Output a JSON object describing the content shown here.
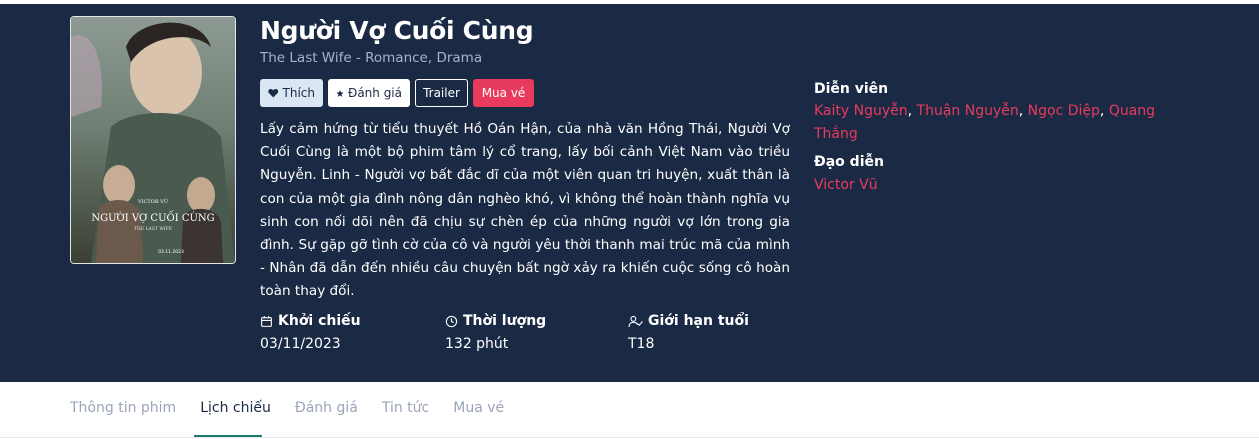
{
  "movie": {
    "title": "Người Vợ Cuối Cùng",
    "subtitle": "The Last Wife - Romance, Drama",
    "poster": {
      "director_credit": "VICTOR VŨ",
      "title": "NGƯỜI VỢ CUỐI CÙNG",
      "subtitle": "THE LAST WIFE",
      "date": "03.11.2023"
    },
    "description": "Lấy cảm hứng từ tiểu thuyết Hồ Oán Hận, của nhà văn Hồng Thái, Người Vợ Cuối Cùng là một bộ phim tâm lý cổ trang, lấy bối cảnh Việt Nam vào triều Nguyễn. Linh - Người vợ bất đắc dĩ của một viên quan tri huyện, xuất thân là con của một gia đình nông dân nghèo khó, vì không thể hoàn thành nghĩa vụ sinh con nối dõi nên đã chịu sự chèn ép của những người vợ lớn trong gia đình. Sự gặp gỡ tình cờ của cô và người yêu thời thanh mai trúc mã của mình - Nhân đã dẫn đến nhiều câu chuyện bất ngờ xảy ra khiến cuộc sống cô hoàn toàn thay đổi."
  },
  "actions": {
    "like": "Thích",
    "rate": "Đánh giá",
    "trailer": "Trailer",
    "buy": "Mua vé"
  },
  "meta": {
    "release_label": "Khởi chiếu",
    "release_value": "03/11/2023",
    "duration_label": "Thời lượng",
    "duration_value": "132 phút",
    "age_label": "Giới hạn tuổi",
    "age_value": "T18"
  },
  "cast": {
    "label": "Diễn viên",
    "actors": [
      "Kaity Nguyễn",
      "Thuận Nguyễn",
      "Ngọc Diệp",
      "Quang Thắng"
    ],
    "separator": ", "
  },
  "director": {
    "label": "Đạo diễn",
    "name": "Victor Vũ"
  },
  "tabs": [
    "Thông tin phim",
    "Lịch chiếu",
    "Đánh giá",
    "Tin tức",
    "Mua vé"
  ],
  "active_tab": "Lịch chiếu",
  "colors": {
    "hero_bg": "#1b2a44",
    "accent": "#e83a5d",
    "tab_underline": "#1f7a6e"
  },
  "icons": [
    "heart-icon",
    "star-icon",
    "calendar-icon",
    "clock-icon",
    "user-check-icon"
  ]
}
